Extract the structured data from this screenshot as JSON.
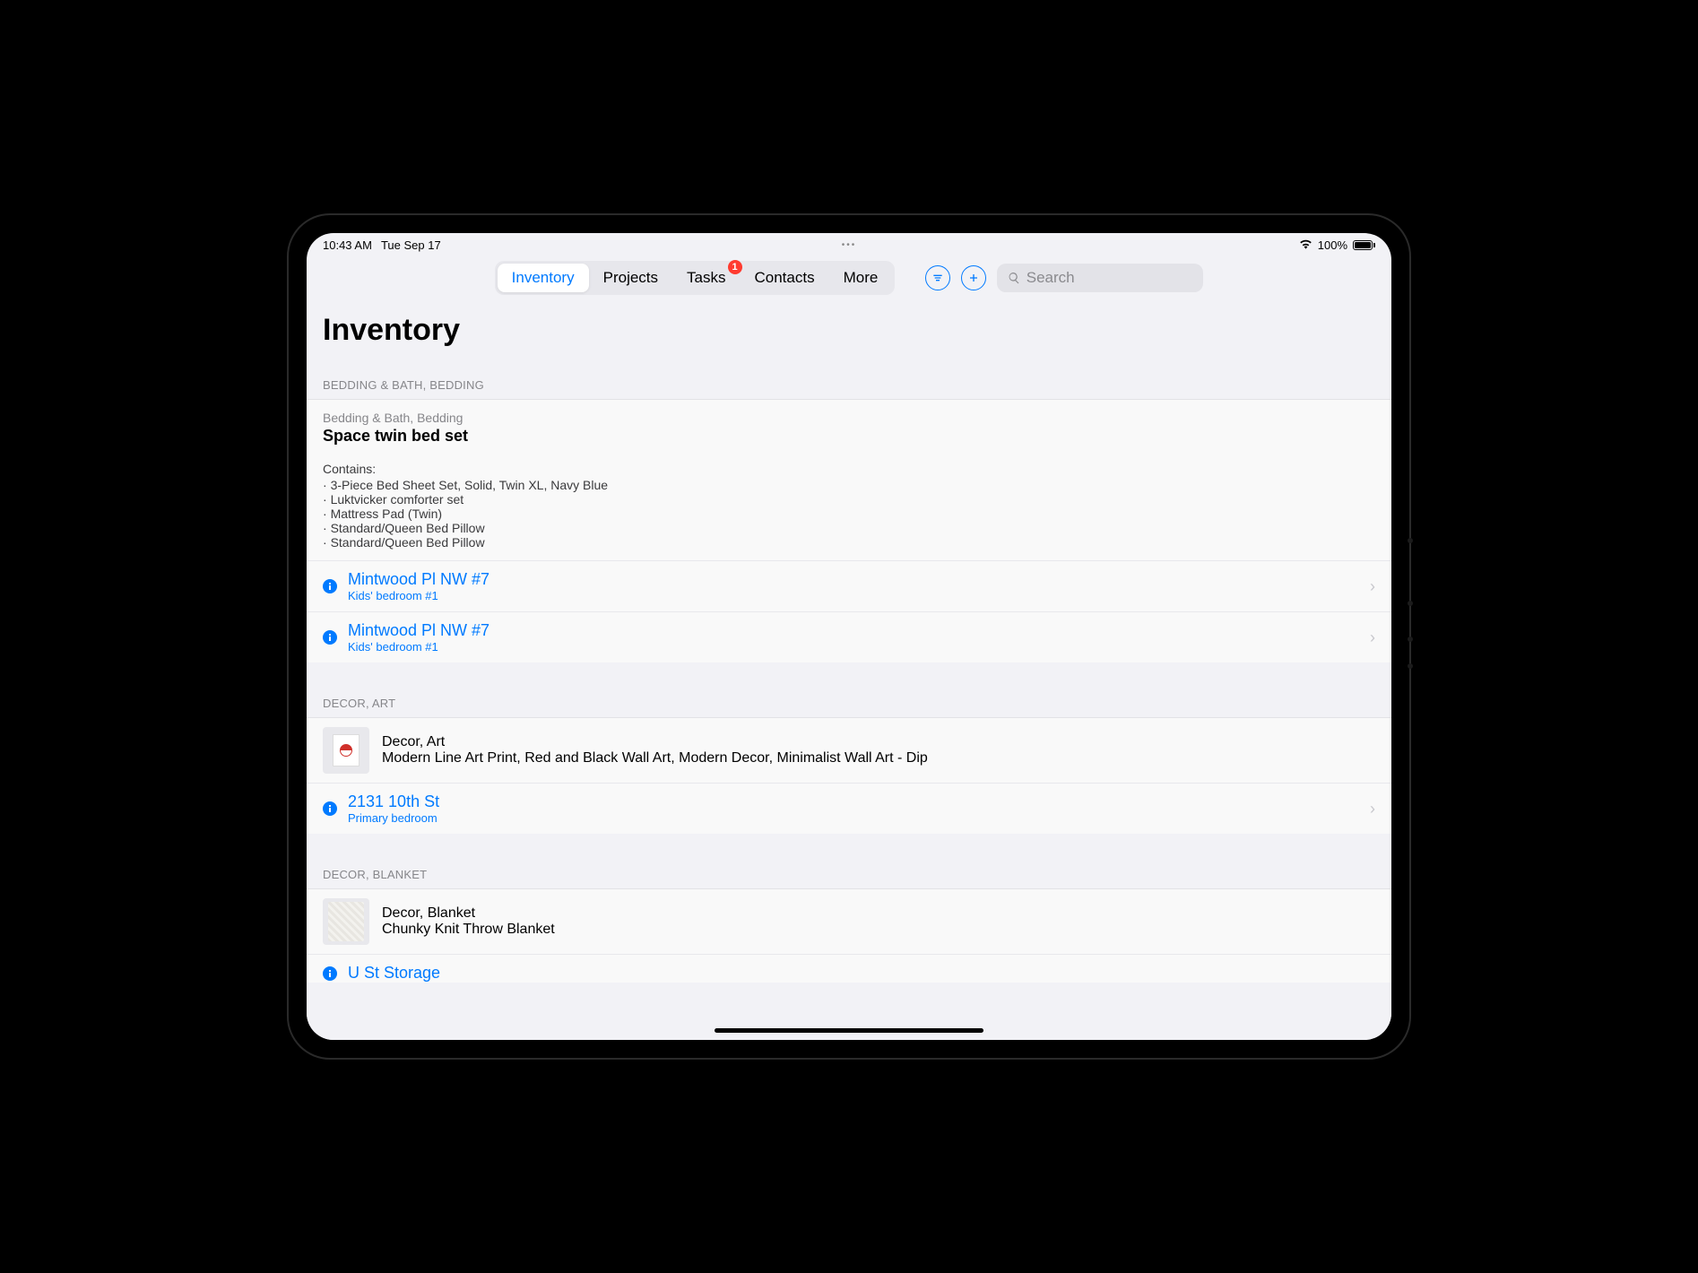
{
  "status": {
    "time": "10:43 AM",
    "date": "Tue Sep 17",
    "battery_pct": "100%"
  },
  "toolbar": {
    "segments": {
      "inventory": "Inventory",
      "projects": "Projects",
      "tasks": "Tasks",
      "tasks_badge": "1",
      "contacts": "Contacts",
      "more": "More"
    },
    "search_placeholder": "Search"
  },
  "page": {
    "title": "Inventory"
  },
  "sections": [
    {
      "header": "BEDDING & BATH, BEDDING",
      "item": {
        "breadcrumb": "Bedding & Bath, Bedding",
        "title": "Space twin bed set",
        "contains_label": "Contains:",
        "contains": [
          "3-Piece Bed Sheet Set, Solid, Twin XL, Navy Blue",
          "Luktvicker comforter set",
          "Mattress Pad (Twin)",
          "Standard/Queen Bed Pillow",
          "Standard/Queen Bed Pillow"
        ]
      },
      "locations": [
        {
          "primary": "Mintwood Pl NW #7",
          "secondary": "Kids' bedroom #1"
        },
        {
          "primary": "Mintwood Pl NW #7",
          "secondary": "Kids' bedroom #1"
        }
      ]
    },
    {
      "header": "DECOR, ART",
      "item": {
        "breadcrumb": "Decor, Art",
        "title": "Modern Line Art Print, Red and Black Wall Art, Modern Decor, Minimalist Wall Art - Dip"
      },
      "locations": [
        {
          "primary": "2131 10th St",
          "secondary": "Primary bedroom"
        }
      ]
    },
    {
      "header": "DECOR, BLANKET",
      "item": {
        "breadcrumb": "Decor, Blanket",
        "title": "Chunky Knit Throw Blanket"
      },
      "locations": [
        {
          "primary": "U St Storage",
          "secondary": ""
        }
      ]
    }
  ]
}
